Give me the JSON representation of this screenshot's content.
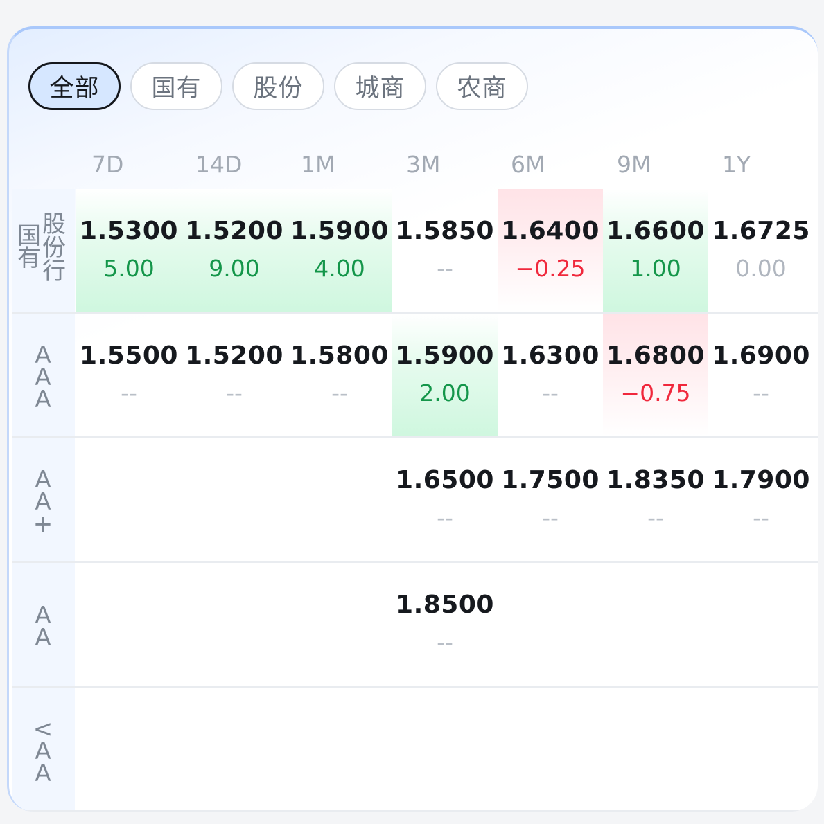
{
  "tabs": [
    {
      "label": "全部",
      "active": true
    },
    {
      "label": "国有",
      "active": false
    },
    {
      "label": "股份",
      "active": false
    },
    {
      "label": "城商",
      "active": false
    },
    {
      "label": "农商",
      "active": false
    }
  ],
  "columns": [
    "7D",
    "14D",
    "1M",
    "3M",
    "6M",
    "9M",
    "1Y"
  ],
  "rows": [
    {
      "label": "国有股份行",
      "label_parts": [
        "国有",
        "股份行"
      ],
      "cells": [
        {
          "rate": "1.5300",
          "change": "5.00",
          "trend": "up"
        },
        {
          "rate": "1.5200",
          "change": "9.00",
          "trend": "up"
        },
        {
          "rate": "1.5900",
          "change": "4.00",
          "trend": "up"
        },
        {
          "rate": "1.5850",
          "change": "--",
          "trend": "none"
        },
        {
          "rate": "1.6400",
          "change": "−0.25",
          "trend": "down"
        },
        {
          "rate": "1.6600",
          "change": "1.00",
          "trend": "up"
        },
        {
          "rate": "1.6725",
          "change": "0.00",
          "trend": "zero"
        }
      ]
    },
    {
      "label": "AAA",
      "cells": [
        {
          "rate": "1.5500",
          "change": "--",
          "trend": "none"
        },
        {
          "rate": "1.5200",
          "change": "--",
          "trend": "none"
        },
        {
          "rate": "1.5800",
          "change": "--",
          "trend": "none"
        },
        {
          "rate": "1.5900",
          "change": "2.00",
          "trend": "up"
        },
        {
          "rate": "1.6300",
          "change": "--",
          "trend": "none"
        },
        {
          "rate": "1.6800",
          "change": "−0.75",
          "trend": "down"
        },
        {
          "rate": "1.6900",
          "change": "--",
          "trend": "none"
        }
      ]
    },
    {
      "label": "AA+",
      "cells": [
        null,
        null,
        null,
        {
          "rate": "1.6500",
          "change": "--",
          "trend": "none"
        },
        {
          "rate": "1.7500",
          "change": "--",
          "trend": "none"
        },
        {
          "rate": "1.8350",
          "change": "--",
          "trend": "none"
        },
        {
          "rate": "1.7900",
          "change": "--",
          "trend": "none"
        }
      ]
    },
    {
      "label": "AA",
      "cells": [
        null,
        null,
        null,
        {
          "rate": "1.8500",
          "change": "--",
          "trend": "none"
        },
        null,
        null,
        null
      ]
    },
    {
      "label": "<AA",
      "cells": [
        null,
        null,
        null,
        null,
        null,
        null,
        null
      ]
    }
  ],
  "colors": {
    "up": "#14964a",
    "down": "#f0283c",
    "neutral": "#b9bfc7",
    "active_tab_bg": "#d6e7ff"
  }
}
